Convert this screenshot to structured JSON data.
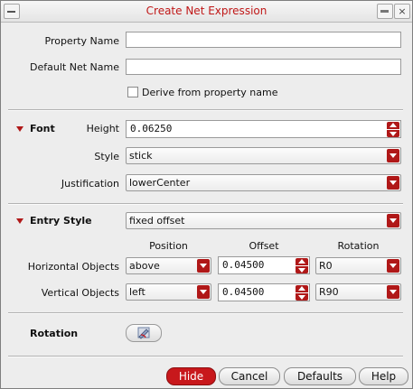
{
  "window": {
    "title": "Create Net Expression"
  },
  "fields": {
    "property_name_label": "Property Name",
    "property_name_value": "",
    "default_net_name_label": "Default Net Name",
    "default_net_name_value": "",
    "derive_label": "Derive from property name",
    "derive_checked": false
  },
  "font": {
    "section_label": "Font",
    "height_label": "Height",
    "height_value": "0.06250",
    "style_label": "Style",
    "style_value": "stick",
    "justification_label": "Justification",
    "justification_value": "lowerCenter"
  },
  "entry": {
    "section_label": "Entry Style",
    "style_value": "fixed offset",
    "col_position": "Position",
    "col_offset": "Offset",
    "col_rotation": "Rotation",
    "rows": [
      {
        "label": "Horizontal Objects",
        "position": "above",
        "offset": "0.04500",
        "rotation": "R0"
      },
      {
        "label": "Vertical Objects",
        "position": "left",
        "offset": "0.04500",
        "rotation": "R90"
      }
    ]
  },
  "rotation": {
    "label": "Rotation",
    "icon": "rotate-icon"
  },
  "buttons": {
    "hide": "Hide",
    "cancel": "Cancel",
    "defaults": "Defaults",
    "help": "Help"
  },
  "colors": {
    "accent": "#c8181c",
    "title_text": "#c01818"
  }
}
